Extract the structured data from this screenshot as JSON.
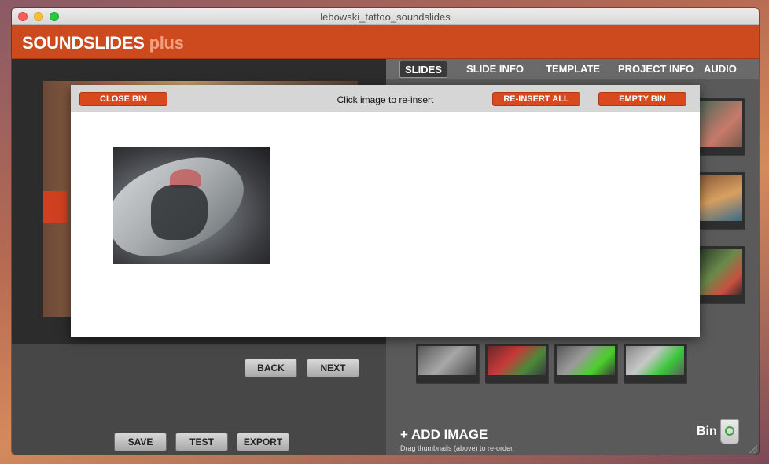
{
  "window": {
    "title": "lebowski_tattoo_soundslides"
  },
  "app": {
    "brand": "SOUNDSLIDES",
    "brand_suffix": "plus",
    "accent": "#cc4a1e"
  },
  "nav": {
    "back": "BACK",
    "next": "NEXT"
  },
  "actions": {
    "save": "SAVE",
    "test": "TEST",
    "export": "EXPORT"
  },
  "tabs": [
    {
      "label": "SLIDES",
      "active": true
    },
    {
      "label": "SLIDE INFO",
      "active": false
    },
    {
      "label": "TEMPLATE",
      "active": false
    },
    {
      "label": "PROJECT INFO",
      "active": false
    },
    {
      "label": "AUDIO",
      "active": false
    }
  ],
  "add_image": {
    "label": "ADD IMAGE",
    "hint": "Drag thumbnails (above) to re-order."
  },
  "bin": {
    "label": "Bin"
  },
  "bin_modal": {
    "close": "CLOSE BIN",
    "message": "Click image to re-insert",
    "reinsert_all": "RE-INSERT  ALL",
    "empty": "EMPTY BIN",
    "images": [
      {
        "alt": ""
      }
    ]
  }
}
